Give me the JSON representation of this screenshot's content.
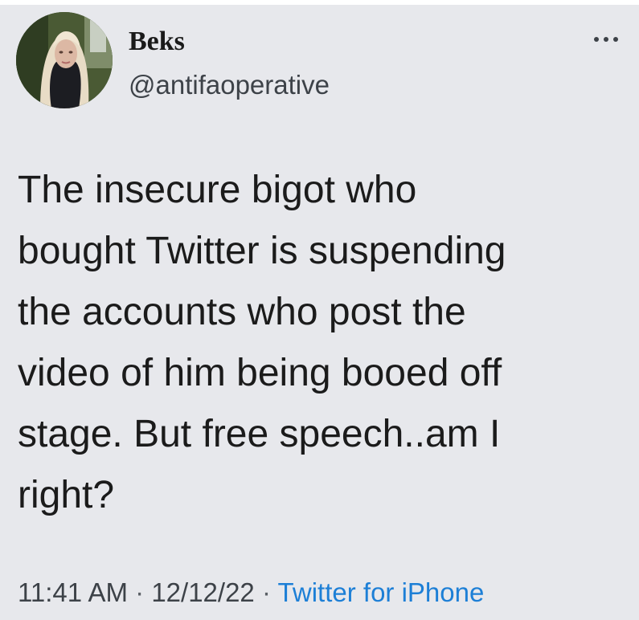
{
  "tweet": {
    "author": {
      "display_name": "Beks",
      "handle": "@antifaoperative",
      "avatar": "user-avatar-photo"
    },
    "more_icon": "ellipsis-icon",
    "text": "The insecure bigot who\nbought Twitter is suspending\nthe accounts who post the\nvideo of him being booed off\nstage. But free speech..am I\nright?",
    "time": "11:41 AM",
    "separator": "·",
    "date": "12/12/22",
    "source": "Twitter for iPhone"
  },
  "colors": {
    "card_background": "#e7e8ec",
    "text": "#1b1b1b",
    "secondary_text": "#3d4248",
    "link": "#1d7fd6"
  }
}
